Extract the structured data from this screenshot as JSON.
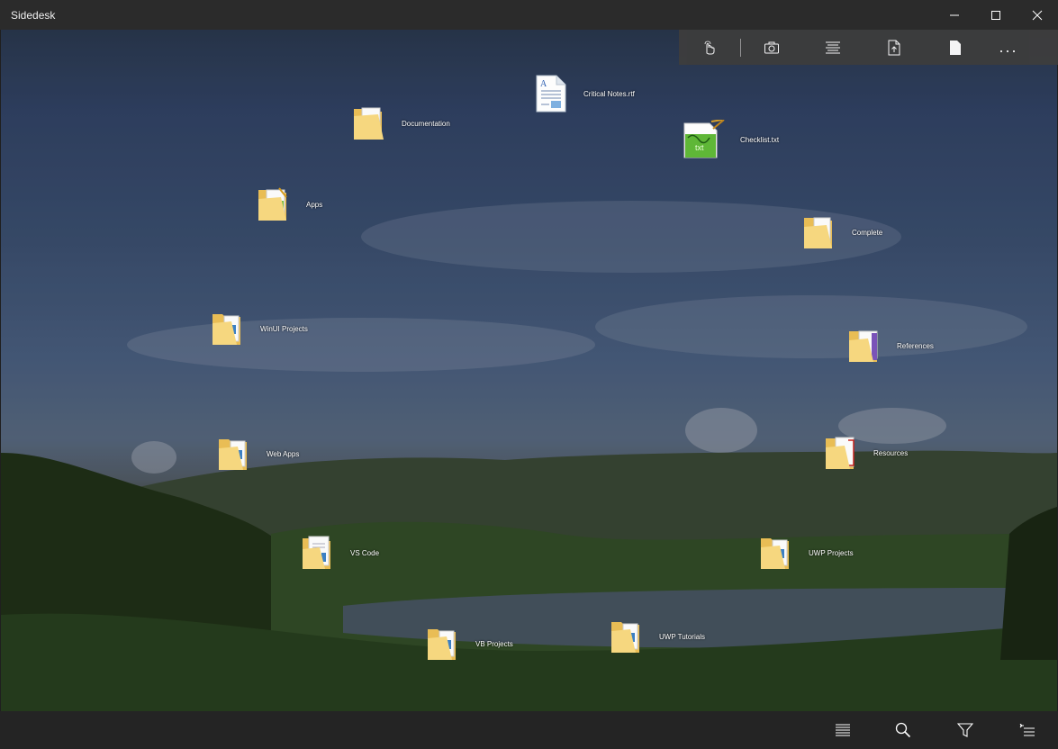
{
  "window": {
    "title": "Sidedesk",
    "controls": [
      "minimize",
      "maximize",
      "close"
    ]
  },
  "toolbar": {
    "items": [
      {
        "icon": "touch-hand-icon"
      },
      {
        "icon": "camera-icon"
      },
      {
        "icon": "text-align-icon"
      },
      {
        "icon": "export-page-icon"
      },
      {
        "icon": "blank-page-icon"
      }
    ],
    "more_label": "..."
  },
  "desktop": {
    "items": [
      {
        "label": "Critical Notes.rtf",
        "type": "file",
        "icon": "rtf-document-icon"
      },
      {
        "label": "Documentation",
        "type": "folder",
        "icon": "folder-pdf-icon"
      },
      {
        "label": "Checklist.txt",
        "type": "file",
        "icon": "text-document-icon"
      },
      {
        "label": "Apps",
        "type": "folder",
        "icon": "folder-apps-icon"
      },
      {
        "label": "Complete",
        "type": "folder",
        "icon": "folder-icon"
      },
      {
        "label": "WinUI Projects",
        "type": "folder",
        "icon": "folder-icon"
      },
      {
        "label": "References",
        "type": "folder",
        "icon": "folder-icon"
      },
      {
        "label": "Web Apps",
        "type": "folder",
        "icon": "folder-icon"
      },
      {
        "label": "Resources",
        "type": "folder",
        "icon": "folder-pdf-icon"
      },
      {
        "label": "VS Code",
        "type": "folder",
        "icon": "folder-icon"
      },
      {
        "label": "UWP Projects",
        "type": "folder",
        "icon": "folder-icon"
      },
      {
        "label": "UWP Tutorials",
        "type": "folder",
        "icon": "folder-icon"
      },
      {
        "label": "VB Projects",
        "type": "folder",
        "icon": "folder-icon"
      }
    ]
  },
  "bottombar": {
    "items": [
      {
        "icon": "list-icon"
      },
      {
        "icon": "search-icon"
      },
      {
        "icon": "filter-icon"
      },
      {
        "icon": "sort-icon"
      }
    ]
  },
  "colors": {
    "titlebar": "#2b2b2b",
    "toolbar": "#3d3d3d",
    "bottombar": "#242424",
    "folder": "#f3d27a"
  }
}
